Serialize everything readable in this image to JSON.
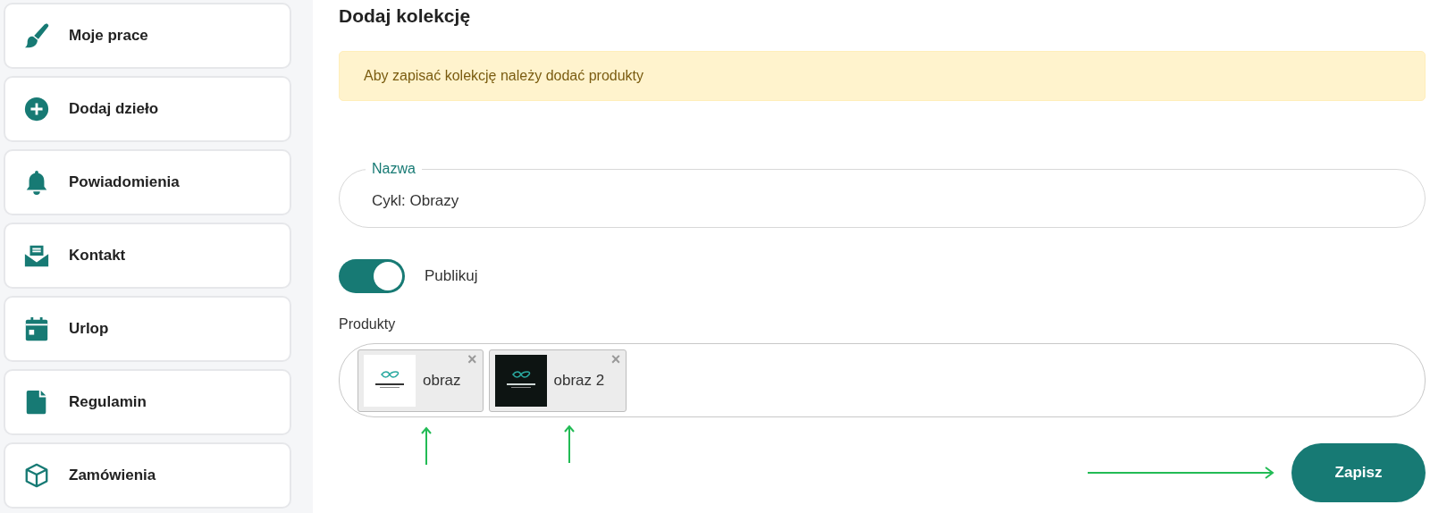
{
  "sidebar": {
    "items": [
      {
        "label": "Moje prace",
        "kind": "brush"
      },
      {
        "label": "Dodaj dzieło",
        "kind": "plus"
      },
      {
        "label": "Powiadomienia",
        "kind": "bell"
      },
      {
        "label": "Kontakt",
        "kind": "mail"
      },
      {
        "label": "Urlop",
        "kind": "calendar"
      },
      {
        "label": "Regulamin",
        "kind": "file"
      },
      {
        "label": "Zamówienia",
        "kind": "box"
      }
    ]
  },
  "title": "Dodaj kolekcję",
  "alert": "Aby zapisać kolekcję należy dodać produkty",
  "name_field": {
    "label": "Nazwa",
    "value": "Cykl: Obrazy"
  },
  "publish": {
    "label": "Publikuj",
    "on": true
  },
  "products": {
    "label": "Produkty",
    "items": [
      {
        "name": "obraz",
        "kind": "light"
      },
      {
        "name": "obraz 2",
        "kind": "dark"
      }
    ],
    "remove": "×"
  },
  "save_button": "Zapisz"
}
